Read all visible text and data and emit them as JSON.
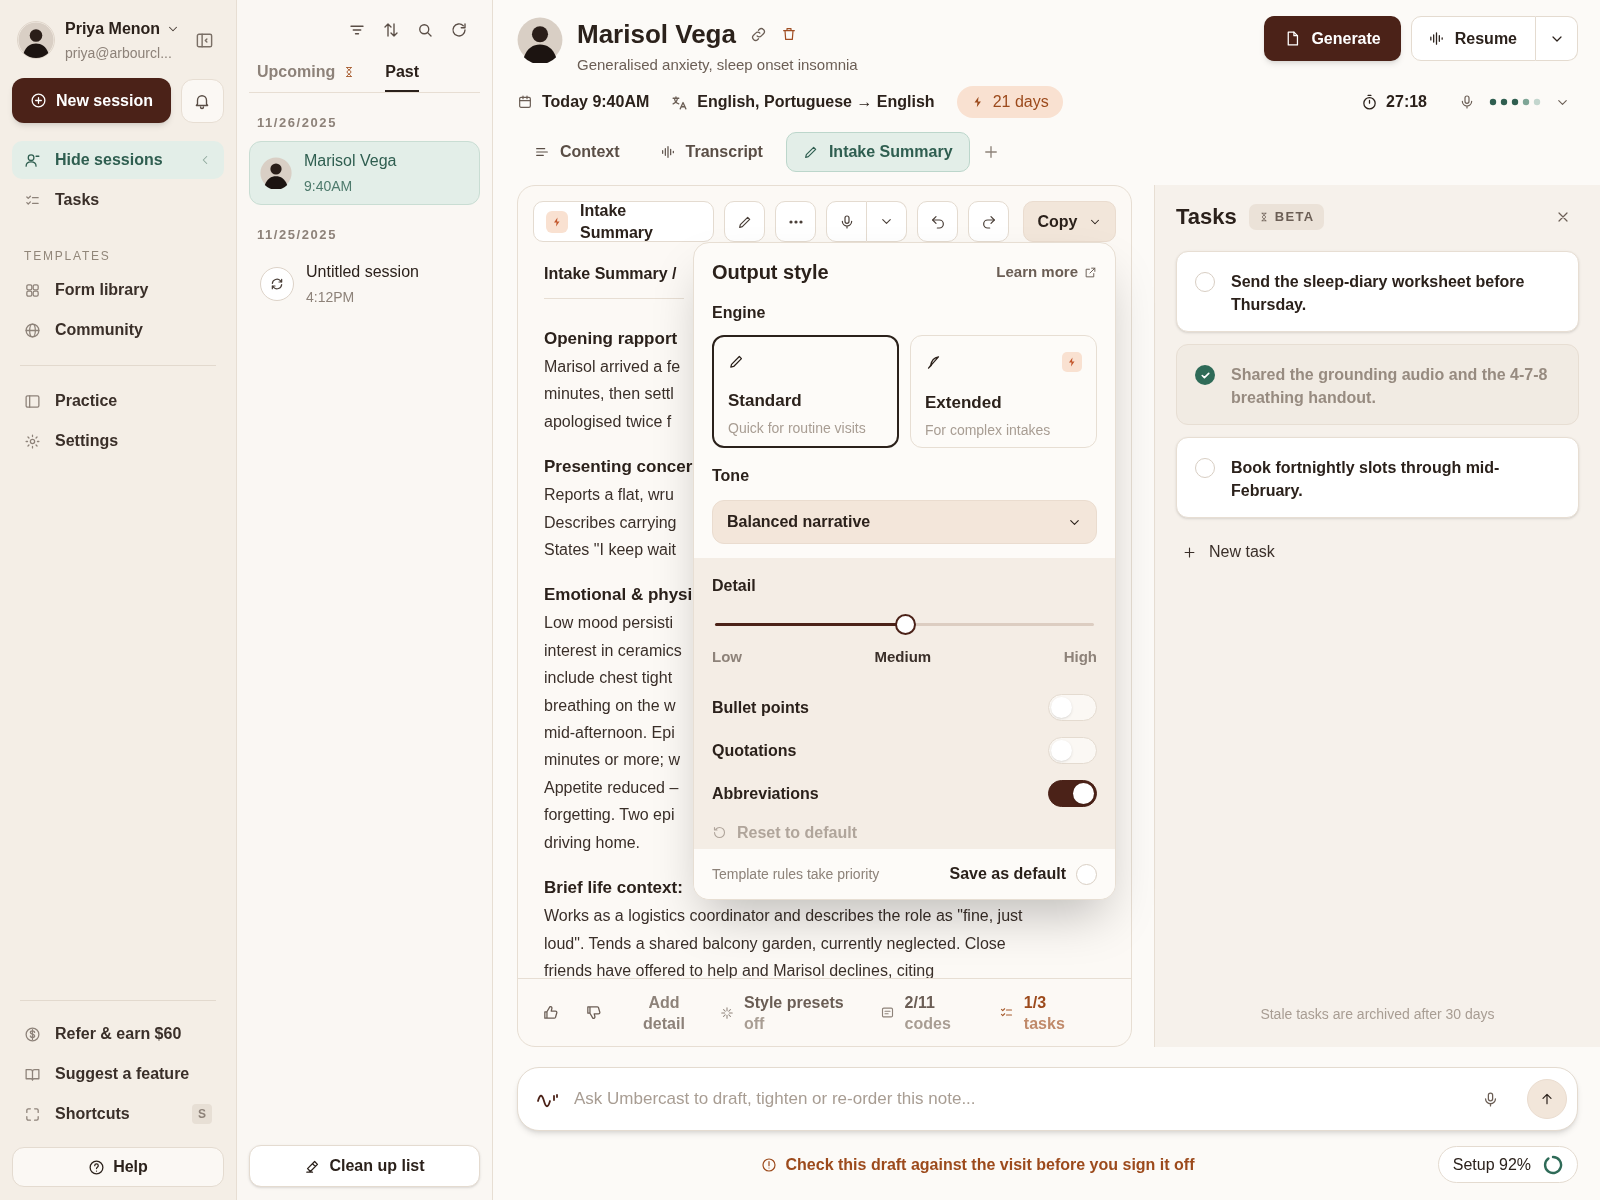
{
  "sidebar": {
    "user": {
      "name": "Priya Menon",
      "email": "priya@arbourcl..."
    },
    "new_session": "New session",
    "nav": [
      {
        "label": "Hide sessions",
        "selected": true
      },
      {
        "label": "Tasks",
        "selected": false
      }
    ],
    "templates_heading": "TEMPLATES",
    "templates": [
      {
        "label": "Form library"
      },
      {
        "label": "Community"
      }
    ],
    "more": [
      {
        "label": "Practice"
      },
      {
        "label": "Settings"
      }
    ],
    "footer_links": [
      {
        "label": "Refer & earn $60"
      },
      {
        "label": "Suggest a feature"
      },
      {
        "label": "Shortcuts",
        "shortcut": "S"
      }
    ],
    "help": "Help"
  },
  "sessions": {
    "tabs": [
      {
        "label": "Upcoming",
        "selected": false
      },
      {
        "label": "Past",
        "selected": true
      }
    ],
    "groups": [
      {
        "date": "11/26/2025",
        "items": [
          {
            "kind": "patient",
            "title": "Marisol Vega",
            "time": "9:40AM",
            "selected": true
          }
        ]
      },
      {
        "date": "11/25/2025",
        "items": [
          {
            "kind": "untitled",
            "title": "Untitled session",
            "time": "4:12PM",
            "selected": false
          }
        ]
      }
    ],
    "clean_up": "Clean up list"
  },
  "header": {
    "name": "Marisol Vega",
    "subtitle": "Generalised anxiety, sleep onset insomnia",
    "generate": "Generate",
    "resume": "Resume",
    "date": "Today 9:40AM",
    "languages": "English, Portuguese → English",
    "badge": "21 days",
    "timer": "27:18"
  },
  "tabs": [
    {
      "label": "Context",
      "selected": false
    },
    {
      "label": "Transcript",
      "selected": false
    },
    {
      "label": "Intake Summary",
      "selected": true
    }
  ],
  "note": {
    "template": "Intake Summary",
    "copy": "Copy",
    "breadcrumb": "Intake Summary /",
    "sections": [
      {
        "heading": "Opening rapport",
        "lines": [
          "Marisol arrived a fe",
          "minutes, then settl",
          "apologised twice f"
        ]
      },
      {
        "heading": "Presenting concer",
        "lines": [
          "Reports a flat, wru",
          "Describes carrying",
          "States \"I keep wait"
        ]
      },
      {
        "heading": "Emotional & physi",
        "lines": [
          "Low mood persisti",
          "interest in ceramics",
          "include chest tight",
          "breathing on the w",
          "mid-afternoon. Epi",
          "minutes or more; w",
          "Appetite reduced –",
          "forgetting. Two epi",
          "driving home."
        ]
      },
      {
        "heading": "Brief life context:",
        "lines": [
          "Works as a logistics coordinator and describes the role as \"fine, just",
          "loud\". Tends a shared balcony garden, currently neglected. Close",
          "friends have offered to help and Marisol declines, citing"
        ]
      }
    ],
    "footer": [
      {
        "kind": "add",
        "label": "Add detail"
      },
      {
        "kind": "presets",
        "label": "Style presets",
        "sub": "off"
      },
      {
        "kind": "codes",
        "label": "2/11",
        "sub": "codes"
      },
      {
        "kind": "tasks",
        "label": "1/3",
        "sub": "tasks"
      }
    ]
  },
  "popover": {
    "title": "Output style",
    "learn_more": "Learn more",
    "engine_label": "Engine",
    "engines": [
      {
        "title": "Standard",
        "desc": "Quick for routine visits",
        "selected": true
      },
      {
        "title": "Extended",
        "desc": "For complex intakes",
        "selected": false
      }
    ],
    "tone_label": "Tone",
    "tone": "Balanced narrative",
    "detail_label": "Detail",
    "detail": {
      "level": 0.5,
      "labels": [
        {
          "label": "Low",
          "selected": false
        },
        {
          "label": "Medium",
          "selected": true
        },
        {
          "label": "High",
          "selected": false
        }
      ]
    },
    "toggles": [
      {
        "label": "Bullet points",
        "on": false
      },
      {
        "label": "Quotations",
        "on": false
      },
      {
        "label": "Abbreviations",
        "on": true
      }
    ],
    "reset": "Reset to default",
    "footer_note": "Template rules take priority",
    "save_default": {
      "label": "Save as default",
      "checked": false
    }
  },
  "tasks": {
    "title": "Tasks",
    "badge": "BETA",
    "items": [
      {
        "text": "Send the sleep-diary worksheet before Thursday.",
        "checked": false
      },
      {
        "text": "Shared the grounding audio and the 4-7-8 breathing handout.",
        "checked": true
      },
      {
        "text": "Book fortnightly slots through mid-February.",
        "checked": false
      }
    ],
    "new_task": "New task",
    "note": "Stale tasks are archived after 30 days"
  },
  "chat": {
    "placeholder": "Ask Umbercast to draft, tighten or re-order this note..."
  },
  "warning": "Check this draft against the visit before you sign it off",
  "setup": {
    "label": "Setup 92%"
  }
}
